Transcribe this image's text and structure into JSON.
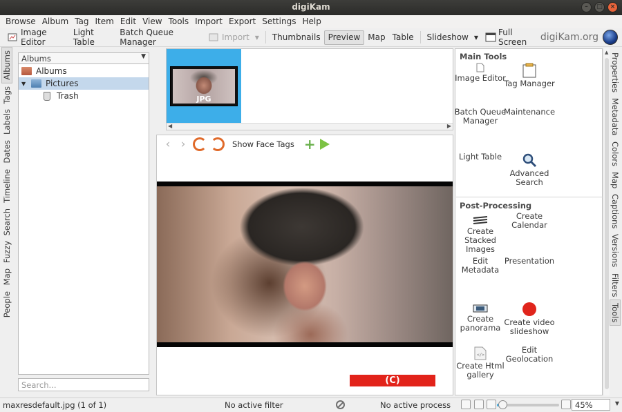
{
  "window": {
    "title": "digiKam"
  },
  "menu": [
    "Browse",
    "Album",
    "Tag",
    "Item",
    "Edit",
    "View",
    "Tools",
    "Import",
    "Export",
    "Settings",
    "Help"
  ],
  "toolbar": {
    "image_editor": "Image Editor",
    "light_table": "Light Table",
    "batch_queue": "Batch Queue Manager",
    "import": "Import",
    "thumbnails": "Thumbnails",
    "preview": "Preview",
    "map": "Map",
    "table": "Table",
    "slideshow": "Slideshow",
    "fullscreen": "Full Screen",
    "brand": "digiKam.org"
  },
  "left_tabs": [
    "Albums",
    "Tags",
    "Labels",
    "Dates",
    "Timeline",
    "Search",
    "Fuzzy",
    "Map",
    "People"
  ],
  "right_tabs": [
    "Properties",
    "Metadata",
    "Colors",
    "Map",
    "Captions",
    "Versions",
    "Filters",
    "Tools"
  ],
  "albums": {
    "combo": "Albums",
    "root": "Albums",
    "child": "Pictures",
    "trash": "Trash",
    "search_placeholder": "Search..."
  },
  "thumb": {
    "badge": "JPG"
  },
  "preview_bar": {
    "show_face_tags": "Show Face Tags"
  },
  "watermark": "(C) fossmint.com",
  "tools": {
    "main_title": "Main Tools",
    "image_editor": "Image Editor",
    "tag_manager": "Tag Manager",
    "batch_queue_1": "Batch Queue",
    "batch_queue_2": "Manager",
    "maintenance": "Maintenance",
    "light_table": "Light Table",
    "advanced_1": "Advanced",
    "advanced_2": "Search",
    "post_title": "Post-Processing",
    "create_calendar_1": "Create",
    "create_calendar_2": "Calendar",
    "stacked_1": "Create",
    "stacked_2": "Stacked",
    "stacked_3": "Images",
    "edit_meta_1": "Edit",
    "edit_meta_2": "Metadata",
    "presentation": "Presentation",
    "panorama_1": "Create",
    "panorama_2": "panorama",
    "video_1": "Create video",
    "video_2": "slideshow",
    "html_1": "Create Html",
    "html_2": "gallery",
    "geo_1": "Edit",
    "geo_2": "Geolocation"
  },
  "status": {
    "file": "maxresdefault.jpg (1 of 1)",
    "filter": "No active filter",
    "process": "No active process",
    "zoom": "45%",
    "zoom_level": 0.45
  }
}
